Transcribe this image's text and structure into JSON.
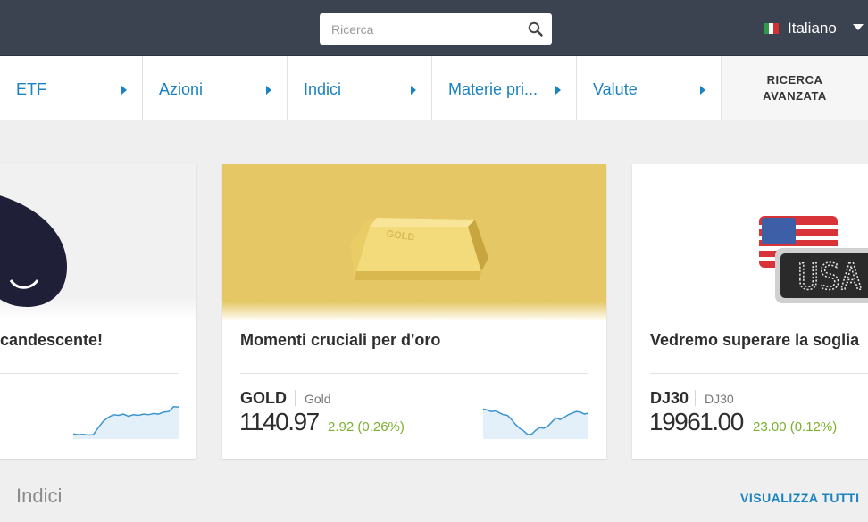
{
  "header": {
    "search_placeholder": "Ricerca",
    "language": "Italiano",
    "flag_colors": [
      "#2e9a4a",
      "#ffffff",
      "#d8302e"
    ]
  },
  "nav": {
    "items": [
      {
        "label": "ETF"
      },
      {
        "label": "Azioni"
      },
      {
        "label": "Indici"
      },
      {
        "label": "Materie pri..."
      },
      {
        "label": "Valute"
      }
    ],
    "advanced_search": "RICERCA AVANZATA",
    "accent_color": "#1a83c1"
  },
  "cards": [
    {
      "title": "candescente!",
      "image": "oil-drop-icon",
      "sparkline": [
        0.1,
        0.08,
        0.09,
        0.07,
        0.08,
        0.3,
        0.5,
        0.62,
        0.7,
        0.68,
        0.72,
        0.65,
        0.7,
        0.68,
        0.72,
        0.7,
        0.74,
        0.72,
        0.78,
        0.8,
        0.95,
        0.94
      ]
    },
    {
      "title": "Momenti cruciali per d'oro",
      "image": "gold-bar-icon",
      "gold_label": "GOLD",
      "symbol": "GOLD",
      "name": "Gold",
      "price": "1140.97",
      "change": "2.92 (0.26%)",
      "sparkline": [
        0.88,
        0.85,
        0.8,
        0.82,
        0.76,
        0.7,
        0.68,
        0.55,
        0.4,
        0.28,
        0.2,
        0.08,
        0.1,
        0.22,
        0.3,
        0.28,
        0.35,
        0.48,
        0.6,
        0.55,
        0.62,
        0.7,
        0.75,
        0.8,
        0.78,
        0.72,
        0.75
      ]
    },
    {
      "title": "Vedremo superare la soglia",
      "image": "usa-flag-display-icon",
      "display_text": "USA",
      "symbol": "DJ30",
      "name": "DJ30",
      "price": "19961.00",
      "change": "23.00 (0.12%)"
    }
  ],
  "section": {
    "title": "Indici",
    "view_all": "VISUALIZZA TUTTI"
  },
  "colors": {
    "topbar": "#3c4350",
    "gold_bg": "#e5c766",
    "positive": "#7ab02e",
    "spark_line": "#3a95d0",
    "spark_fill": "#e3f0fa"
  }
}
